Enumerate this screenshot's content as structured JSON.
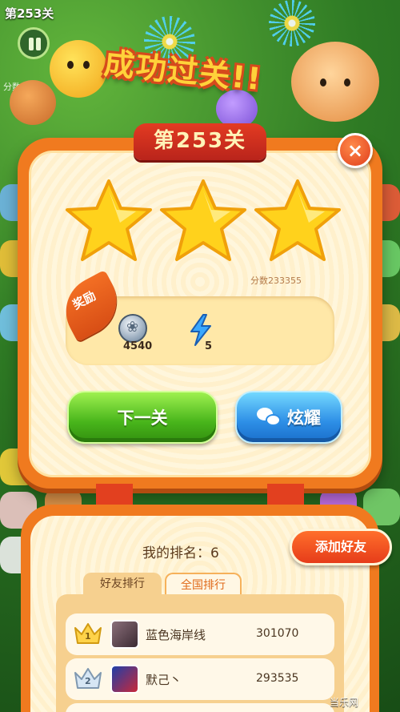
{
  "background": {
    "level_label": "第253关",
    "score_label": "分数"
  },
  "banner": {
    "title": "成功过关!!"
  },
  "result": {
    "level_title": "第253关",
    "stars_earned": 3,
    "stars_total": 3,
    "score_text": "分数233355",
    "close_label": "×"
  },
  "rewards": {
    "tag": "奖励",
    "coins": "4540",
    "energy": "5"
  },
  "buttons": {
    "next_level": "下一关",
    "share": "炫耀"
  },
  "ranking": {
    "my_rank": "我的排名：6",
    "add_friend": "添加好友",
    "tabs": [
      {
        "label": "好友排行",
        "active": false
      },
      {
        "label": "全国排行",
        "active": true
      }
    ],
    "entries": [
      {
        "rank": "1",
        "name": "蓝色海岸线",
        "score": "301070"
      },
      {
        "rank": "2",
        "name": "默己丶",
        "score": "293535"
      }
    ]
  },
  "watermark": "当乐网",
  "colors": {
    "panel_orange": "#f07a1f",
    "title_red": "#d64a1c",
    "next_green": "#48b51b",
    "share_blue": "#2d8ee6",
    "star_yellow": "#ffd21c"
  }
}
